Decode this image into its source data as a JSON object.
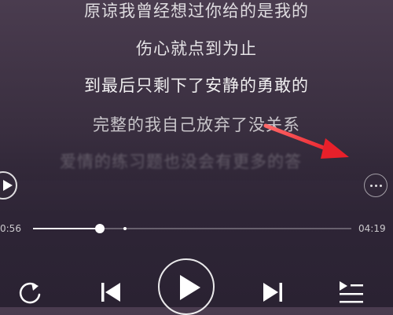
{
  "lyrics": [
    "原谅我曾经想过你给的是我的",
    "伤心就点到为止",
    "到最后只剩下了安静的勇敢的",
    "完整的我自己放弃了没关系",
    "爱情的练习题也没会有更多的答"
  ],
  "player": {
    "current_time": "0:56",
    "total_time": "04:19",
    "progress": 0.21,
    "buffered": 0.29
  },
  "colors": {
    "accent_arrow": "#e8202a",
    "background": "#3a2f40"
  },
  "icons": {
    "side_play": "play-icon",
    "more": "more-icon",
    "repeat": "repeat-icon",
    "previous": "previous-icon",
    "play": "play-icon",
    "next": "next-icon",
    "playlist": "playlist-icon"
  }
}
